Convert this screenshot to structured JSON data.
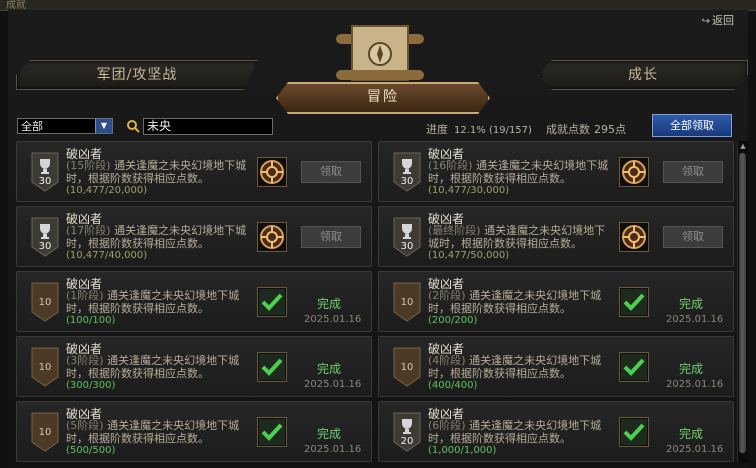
{
  "window": {
    "title": "成就"
  },
  "header": {
    "return_label": "返回",
    "tabs": [
      {
        "label": "军团/攻坚战"
      },
      {
        "label": "冒险"
      },
      {
        "label": "成长"
      }
    ]
  },
  "toolbar": {
    "filter_selected": "全部",
    "search_value": "未央",
    "progress_label": "进度",
    "progress_value": "12.1% (19/157)",
    "points_label": "成就点数",
    "points_value": "295点",
    "claim_all_label": "全部领取"
  },
  "achievements": [
    {
      "name": "破凶者",
      "stage": "(15阶段)",
      "desc": "通关逢魔之未央幻境地下城时，根据阶数获得相应点数。",
      "progress": "(10,477/20,000)",
      "points": "30",
      "claim_label": "领取",
      "status": "",
      "date": ""
    },
    {
      "name": "破凶者",
      "stage": "(16阶段)",
      "desc": "通关逢魔之未央幻境地下城时，根据阶数获得相应点数。",
      "progress": "(10,477/30,000)",
      "points": "30",
      "claim_label": "领取",
      "status": "",
      "date": ""
    },
    {
      "name": "破凶者",
      "stage": "(17阶段)",
      "desc": "通关逢魔之未央幻境地下城时，根据阶数获得相应点数。",
      "progress": "(10,477/40,000)",
      "points": "30",
      "claim_label": "领取",
      "status": "",
      "date": ""
    },
    {
      "name": "破凶者",
      "stage": "(最终阶段)",
      "desc": "通关逢魔之未央幻境地下城时，根据阶数获得相应点数。",
      "progress": "(10,477/50,000)",
      "points": "30",
      "claim_label": "领取",
      "status": "",
      "date": ""
    },
    {
      "name": "破凶者",
      "stage": "(1阶段)",
      "desc": "通关逢魔之未央幻境地下城时，根据阶数获得相应点数。",
      "progress": "(100/100)",
      "points": "10",
      "claim_label": "",
      "status": "完成",
      "date": "2025.01.16"
    },
    {
      "name": "破凶者",
      "stage": "(2阶段)",
      "desc": "通关逢魔之未央幻境地下城时，根据阶数获得相应点数。",
      "progress": "(200/200)",
      "points": "10",
      "claim_label": "",
      "status": "完成",
      "date": "2025.01.16"
    },
    {
      "name": "破凶者",
      "stage": "(3阶段)",
      "desc": "通关逢魔之未央幻境地下城时，根据阶数获得相应点数。",
      "progress": "(300/300)",
      "points": "10",
      "claim_label": "",
      "status": "完成",
      "date": "2025.01.16"
    },
    {
      "name": "破凶者",
      "stage": "(4阶段)",
      "desc": "通关逢魔之未央幻境地下城时，根据阶数获得相应点数。",
      "progress": "(400/400)",
      "points": "10",
      "claim_label": "",
      "status": "完成",
      "date": "2025.01.16"
    },
    {
      "name": "破凶者",
      "stage": "(5阶段)",
      "desc": "通关逢魔之未央幻境地下城时，根据阶数获得相应点数。",
      "progress": "(500/500)",
      "points": "10",
      "claim_label": "",
      "status": "完成",
      "date": "2025.01.16"
    },
    {
      "name": "破凶者",
      "stage": "(6阶段)",
      "desc": "通关逢魔之未央幻境地下城时，根据阶数获得相应点数。",
      "progress": "(1,000/1,000)",
      "points": "20",
      "claim_label": "",
      "status": "完成",
      "date": "2025.01.16"
    }
  ]
}
